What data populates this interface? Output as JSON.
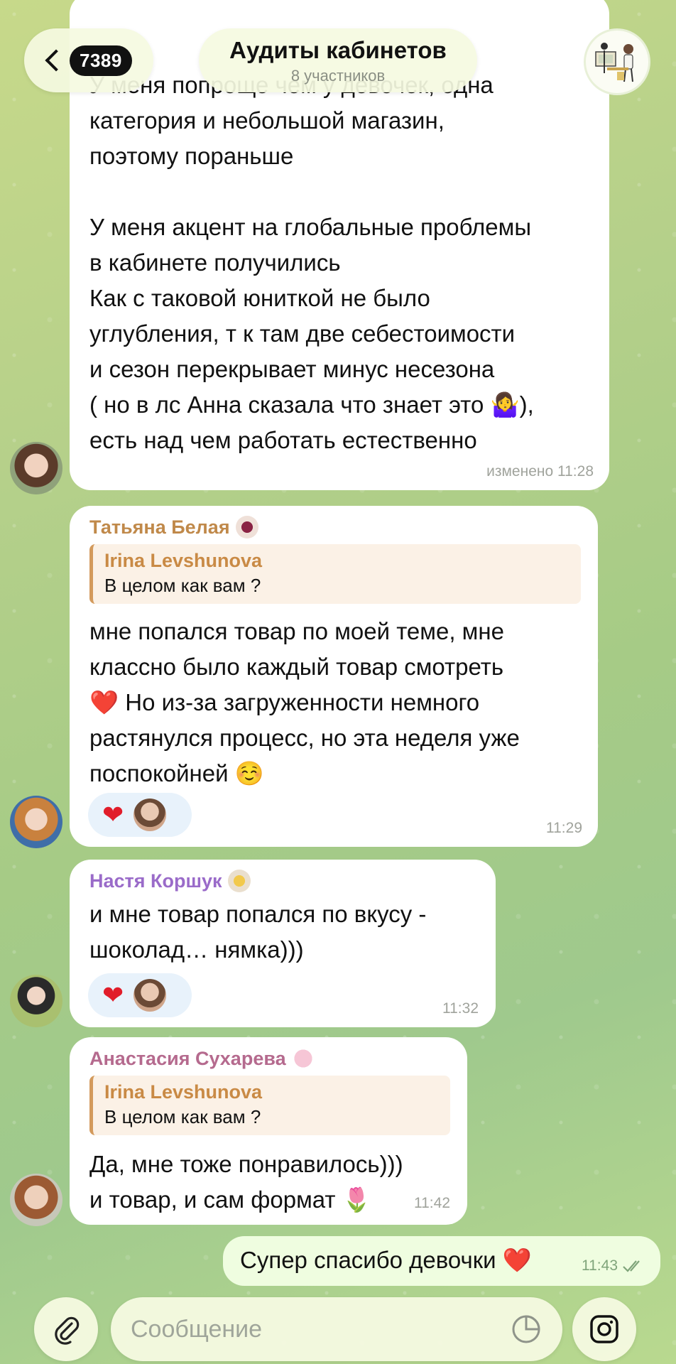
{
  "header": {
    "back_count": "7389",
    "title": "Аудиты кабинетов",
    "subtitle": "8 участников"
  },
  "messages": [
    {
      "text": "У меня попроще чем у девочек, одна\nкатегория и небольшой магазин,\nпоэтому пораньше\n\nУ меня акцент на глобальные проблемы\nв кабинете получились\nКак с таковой юниткой не было\nуглубления, т к там две себестоимости\nи сезон перекрывает минус несезона\n( но в лс Анна сказала что знает это 🤷‍♀️),\nесть над чем работать естественно",
      "time": "изменено 11:28"
    },
    {
      "sender": "Татьяна Белая",
      "sender_color": "#c0894a",
      "reply": {
        "name": "Irina Levshunova",
        "text": "В целом как вам ?"
      },
      "text": "мне попался товар по моей теме, мне\nклассно было каждый товар смотреть\n❤️ Но из-за загруженности немного\nрастянулся процесс, но эта неделя уже\nпоспокойней ☺️",
      "reaction": "❤",
      "time": "11:29"
    },
    {
      "sender": "Настя Коршук",
      "sender_color": "#9a6bc9",
      "text": "и мне товар попался по вкусу -\nшоколад… нямка)))",
      "reaction": "❤",
      "time": "11:32"
    },
    {
      "sender": "Анастасия Сухарева",
      "sender_color": "#b56a8e",
      "reply": {
        "name": "Irina Levshunova",
        "text": "В целом как вам ?"
      },
      "text": "Да, мне тоже понравилось)))\nи товар, и сам формат 🌷",
      "time": "11:42"
    },
    {
      "text": "Супер спасибо девочки ❤️",
      "time": "11:43"
    }
  ],
  "composer": {
    "placeholder": "Сообщение"
  },
  "icons": {
    "back": "chevron-left-icon",
    "attach": "paperclip-icon",
    "sticker": "sticker-icon",
    "camera": "instagram-camera-icon",
    "read": "double-check-icon"
  }
}
